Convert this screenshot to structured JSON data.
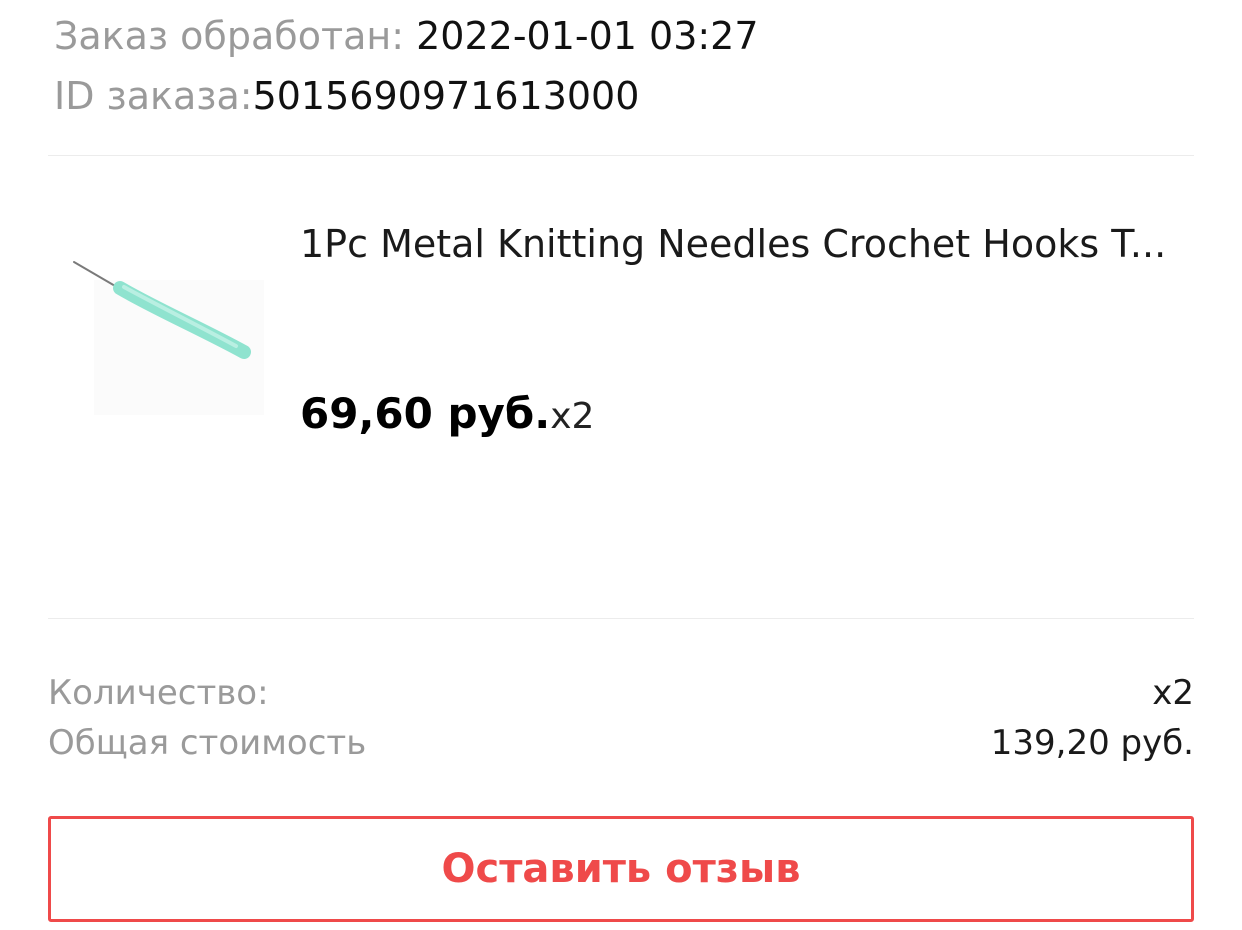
{
  "order": {
    "processed_label": "Заказ обработан:",
    "processed_value": "2022-01-01 03:27",
    "id_label": "ID заказа:",
    "id_value": "5015690971613000"
  },
  "product": {
    "image_icon": "crochet-hook-image",
    "title": "1Pc Metal Knitting Needles Crochet Hooks T...",
    "price": "69,60 руб.",
    "quantity": "x2"
  },
  "summary": {
    "quantity_label": "Количество:",
    "quantity_value": "x2",
    "total_label": "Общая стоимость",
    "total_value": "139,20 руб."
  },
  "actions": {
    "review_label": "Оставить отзыв"
  },
  "colors": {
    "accent": "#ef4a4a",
    "muted_text": "#9a9a9a",
    "divider": "#ececec",
    "hook_handle": "#8fe3cf"
  }
}
